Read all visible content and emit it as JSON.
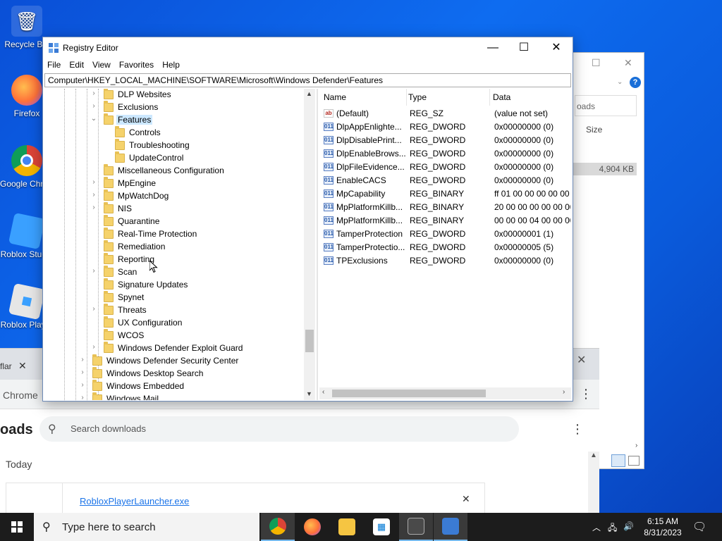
{
  "desktop": {
    "icons": [
      {
        "label": "Recycle Bin"
      },
      {
        "label": "Firefox"
      },
      {
        "label": "Google Chrome"
      },
      {
        "label": "Roblox Studio"
      },
      {
        "label": "Roblox Player"
      }
    ]
  },
  "explorer_bg": {
    "search_frag": "oads",
    "size_header": "Size",
    "size_value": "4,904 KB"
  },
  "chrome": {
    "tab_frag": "flar",
    "label": "Chrome",
    "page_title": "oads",
    "search_placeholder": "Search downloads",
    "today": "Today",
    "file_name": "RobloxPlayerLauncher.exe"
  },
  "regedit": {
    "title": "Registry Editor",
    "menu": [
      "File",
      "Edit",
      "View",
      "Favorites",
      "Help"
    ],
    "address": "Computer\\HKEY_LOCAL_MACHINE\\SOFTWARE\\Microsoft\\Windows Defender\\Features",
    "tree": [
      {
        "label": "DLP Websites",
        "expander": "›"
      },
      {
        "label": "Exclusions",
        "expander": "›"
      },
      {
        "label": "Features",
        "expander": "⌄",
        "selected": true
      },
      {
        "label": "Controls",
        "expander": ""
      },
      {
        "label": "Troubleshooting",
        "expander": ""
      },
      {
        "label": "UpdateControl",
        "expander": ""
      },
      {
        "label": "Miscellaneous Configuration",
        "expander": ""
      },
      {
        "label": "MpEngine",
        "expander": "›"
      },
      {
        "label": "MpWatchDog",
        "expander": "›"
      },
      {
        "label": "NIS",
        "expander": "›"
      },
      {
        "label": "Quarantine",
        "expander": ""
      },
      {
        "label": "Real-Time Protection",
        "expander": ""
      },
      {
        "label": "Remediation",
        "expander": ""
      },
      {
        "label": "Reporting",
        "expander": ""
      },
      {
        "label": "Scan",
        "expander": "›"
      },
      {
        "label": "Signature Updates",
        "expander": ""
      },
      {
        "label": "Spynet",
        "expander": ""
      },
      {
        "label": "Threats",
        "expander": "›"
      },
      {
        "label": "UX Configuration",
        "expander": ""
      },
      {
        "label": "WCOS",
        "expander": ""
      },
      {
        "label": "Windows Defender Exploit Guard",
        "expander": "›"
      },
      {
        "label": "Windows Defender Security Center",
        "expander": "›"
      },
      {
        "label": "Windows Desktop Search",
        "expander": "›"
      },
      {
        "label": "Windows Embedded",
        "expander": "›"
      },
      {
        "label": "Windows Mail",
        "expander": "›"
      }
    ],
    "columns": {
      "name": "Name",
      "type": "Type",
      "data": "Data"
    },
    "values": [
      {
        "name": "(Default)",
        "type": "REG_SZ",
        "data": "(value not set)",
        "icon": "ab"
      },
      {
        "name": "DlpAppEnlighte...",
        "type": "REG_DWORD",
        "data": "0x00000000 (0)",
        "icon": "011"
      },
      {
        "name": "DlpDisablePrint...",
        "type": "REG_DWORD",
        "data": "0x00000000 (0)",
        "icon": "011"
      },
      {
        "name": "DlpEnableBrows...",
        "type": "REG_DWORD",
        "data": "0x00000000 (0)",
        "icon": "011"
      },
      {
        "name": "DlpFileEvidence...",
        "type": "REG_DWORD",
        "data": "0x00000000 (0)",
        "icon": "011"
      },
      {
        "name": "EnableCACS",
        "type": "REG_DWORD",
        "data": "0x00000000 (0)",
        "icon": "011"
      },
      {
        "name": "MpCapability",
        "type": "REG_BINARY",
        "data": "ff 01 00 00 00 00 00 00",
        "icon": "011"
      },
      {
        "name": "MpPlatformKillb...",
        "type": "REG_BINARY",
        "data": "20 00 00 00 00 00 00 0",
        "icon": "011"
      },
      {
        "name": "MpPlatformKillb...",
        "type": "REG_BINARY",
        "data": "00 00 00 04 00 00 00 0",
        "icon": "011"
      },
      {
        "name": "TamperProtection",
        "type": "REG_DWORD",
        "data": "0x00000001 (1)",
        "icon": "011"
      },
      {
        "name": "TamperProtectio...",
        "type": "REG_DWORD",
        "data": "0x00000005 (5)",
        "icon": "011"
      },
      {
        "name": "TPExclusions",
        "type": "REG_DWORD",
        "data": "0x00000000 (0)",
        "icon": "011"
      }
    ]
  },
  "taskbar": {
    "search_placeholder": "Type here to search",
    "time": "6:15 AM",
    "date": "8/31/2023"
  }
}
